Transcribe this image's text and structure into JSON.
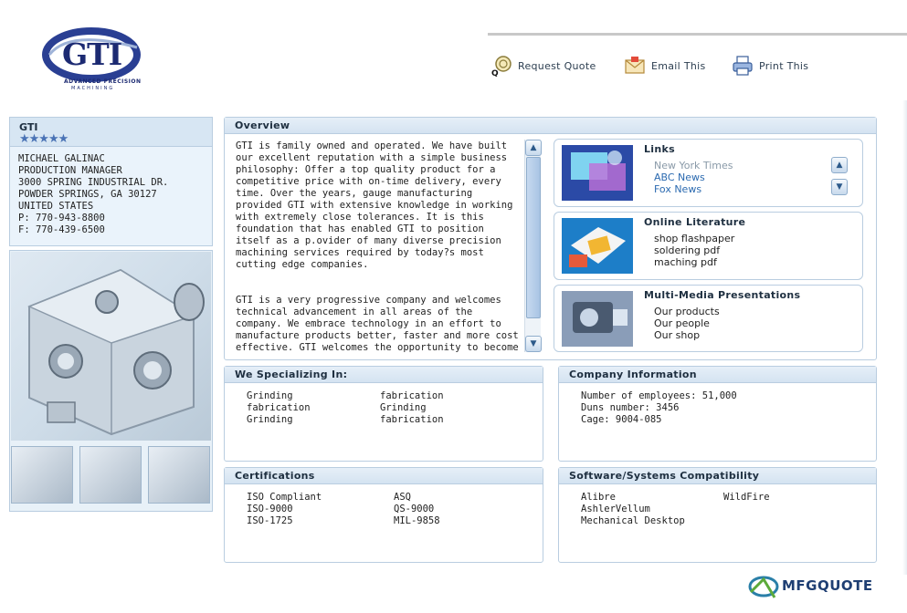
{
  "header": {
    "logo_text": "GTI",
    "logo_tagline_1": "ADVANCED PRECISION",
    "logo_tagline_2": "MACHINING",
    "actions": [
      {
        "label": "Request Quote",
        "icon": "request-quote-icon"
      },
      {
        "label": "Email This",
        "icon": "email-icon"
      },
      {
        "label": "Print This",
        "icon": "printer-icon"
      }
    ]
  },
  "contact": {
    "company": "GTI",
    "rating_stars": "★★★★★",
    "rating": 5,
    "lines": [
      "MICHAEL GALINAC",
      "PRODUCTION MANAGER",
      "3000 SPRING INDUSTRIAL DR.",
      "POWDER SPRINGS, GA 30127",
      "UNITED STATES",
      "P: 770-943-8800",
      "F: 770-439-6500"
    ]
  },
  "overview": {
    "title": "Overview",
    "para1": "GTI is family owned and operated. We have built our excellent reputation with a simple business philosophy: Offer a top quality product for a competitive price with on-time delivery, every time. Over the years, gauge manufacturing provided GTI with extensive knowledge in working with extremely close tolerances. It is this foundation that has enabled GTI to position itself as a p.ovider of many diverse precision machining services required by today?s most cutting edge companies.",
    "para2": "GTI is a very progressive company and welcomes technical advancement in all areas of the company. We embrace technology in an effort to manufacture products better, faster and more cost effective. GTI welcomes the opportunity to become your company?s source for is precision machining and"
  },
  "links": {
    "title": "Links",
    "items": [
      "New York Times",
      "ABC News",
      "Fox News"
    ]
  },
  "literature": {
    "title": "Online Literature",
    "items": [
      "shop flashpaper",
      "soldering pdf",
      "maching pdf"
    ]
  },
  "multimedia": {
    "title": "Multi-Media Presentations",
    "items": [
      "Our products",
      "Our people",
      "Our shop"
    ]
  },
  "specializing": {
    "title": "We Specializing In:",
    "col1": [
      "Grinding",
      "fabrication",
      "Grinding"
    ],
    "col2": [
      "fabrication",
      "Grinding",
      "fabrication"
    ]
  },
  "company_info": {
    "title": "Company Information",
    "lines": [
      "Number of employees: 51,000",
      "Duns number: 3456",
      "Cage: 9004-085"
    ]
  },
  "certifications": {
    "title": "Certifications",
    "col1": [
      "ISO Compliant",
      "ISO-9000",
      "ISO-1725"
    ],
    "col2": [
      "ASQ",
      "QS-9000",
      "MIL-9858"
    ]
  },
  "software": {
    "title": "Software/Systems Compatibility",
    "col1": [
      "Alibre",
      "AshlerVellum",
      "Mechanical Desktop"
    ],
    "col2": [
      "WildFire"
    ]
  },
  "footer": {
    "brand": "MFGQUOTE"
  }
}
